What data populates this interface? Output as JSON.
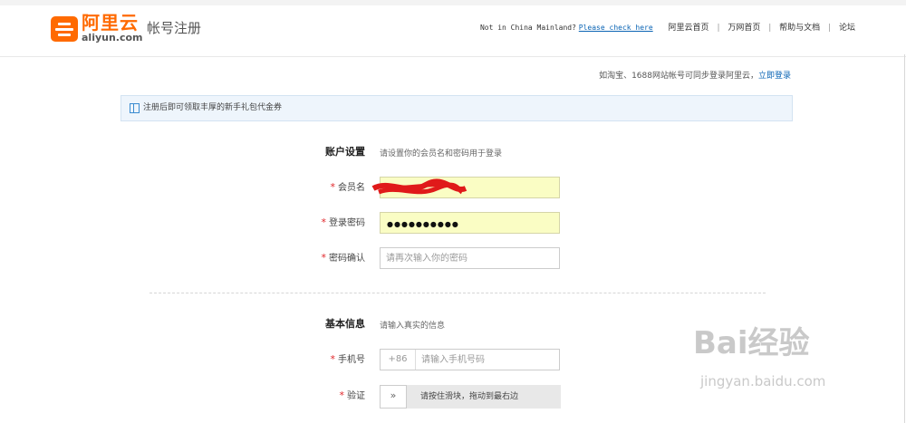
{
  "header": {
    "logo_cn": "阿里云",
    "logo_en": "aliyun.com",
    "page_title": "帐号注册",
    "not_in_china": "Not in China Mainland?",
    "check_link": "Please check here",
    "nav": [
      "阿里云首页",
      "万网首页",
      "帮助与文档",
      "论坛"
    ]
  },
  "login_hint": {
    "text": "如淘宝、1688网站帐号可同步登录阿里云，",
    "link": "立即登录"
  },
  "notice": {
    "text": "注册后即可领取丰厚的新手礼包代金券",
    "icon": "gift-icon"
  },
  "account": {
    "title": "账户设置",
    "desc": "请设置你的会员名和密码用于登录",
    "username_label": "会员名",
    "password_label": "登录密码",
    "password_value": "●●●●●●●●●●",
    "confirm_label": "密码确认",
    "confirm_placeholder": "请再次输入你的密码"
  },
  "basic": {
    "title": "基本信息",
    "desc": "请输入真实的信息",
    "phone_label": "手机号",
    "phone_prefix": "+86",
    "phone_placeholder": "请输入手机号码",
    "verify_label": "验证",
    "slider_handle": "»",
    "slider_text": "请按住滑块，拖动到最右边"
  },
  "required_mark": "*",
  "watermark": {
    "brand": "Bai经验",
    "url": "jingyan.baidu.com"
  },
  "colors": {
    "brand_orange": "#ff6a00",
    "link_blue": "#0a64b4",
    "required_red": "#e0262a",
    "autofill_yellow": "#fafdc4"
  }
}
